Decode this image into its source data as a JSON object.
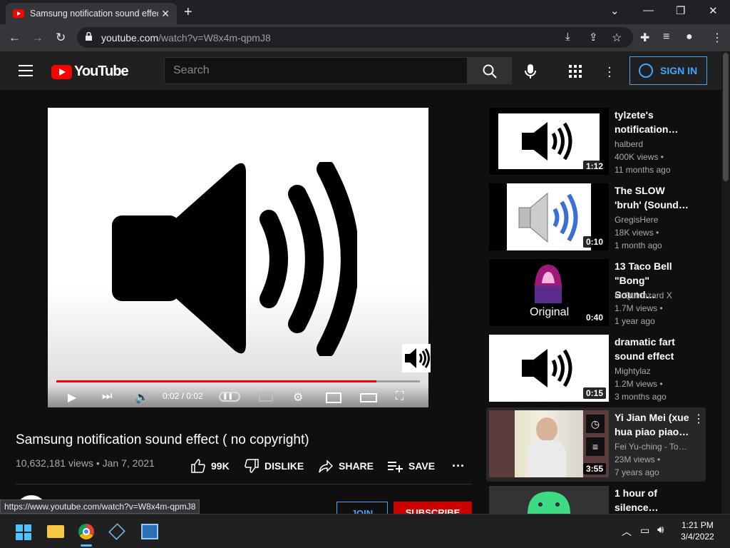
{
  "browser": {
    "tab_title": "Samsung notification sound effect ( no copyright) - YouTube",
    "url_domain": "youtube.com",
    "url_path": "/watch?v=W8x4m-qpmJ8",
    "status_url": "https://www.youtube.com/watch?v=W8x4m-qpmJ8"
  },
  "header": {
    "logo_text": "YouTube",
    "search_placeholder": "Search",
    "signin_label": "SIGN IN"
  },
  "player": {
    "time": "0:02 / 0:02",
    "progress": 0.88
  },
  "video": {
    "title": "Samsung notification sound effect ( no copyright)",
    "meta": "10,632,181 views • Jan 7, 2021",
    "likes": "99K",
    "dislike_label": "DISLIKE",
    "share_label": "SHARE",
    "save_label": "SAVE",
    "join_label": "JOIN",
    "subscribe_label": "SUBSCRIBE"
  },
  "recommendations": [
    {
      "title_l1": "tylzete's",
      "title_l2": "notification…",
      "channel": "halberd",
      "views": "400K views •",
      "age": "11 months ago",
      "duration": "1:12"
    },
    {
      "title_l1": "The SLOW",
      "title_l2": "'bruh' (Sound…",
      "channel": "GregisHere",
      "views": "18K views •",
      "age": "1 month ago",
      "duration": "0:10"
    },
    {
      "title_l1": "13 Taco Bell",
      "title_l2": "\"Bong\" Sound…",
      "channel": "MrQuinnzard X",
      "views": "1.7M views •",
      "age": "1 year ago",
      "duration": "0:40",
      "thumb_text": "Original"
    },
    {
      "title_l1": "dramatic fart",
      "title_l2": "sound effect",
      "channel": "Mightylaz",
      "views": "1.2M views •",
      "age": "3 months ago",
      "duration": "0:15"
    },
    {
      "title_l1": "Yi Jian Mei (xue",
      "title_l2": "hua piao piao…",
      "channel": "Fei Yu-ching - To…",
      "views": "23M views •",
      "age": "7 years ago",
      "duration": "3:55"
    },
    {
      "title_l1": "1 hour of",
      "title_l2": "silence…"
    }
  ],
  "taskbar": {
    "time": "1:21 PM",
    "date": "3/4/2022"
  }
}
